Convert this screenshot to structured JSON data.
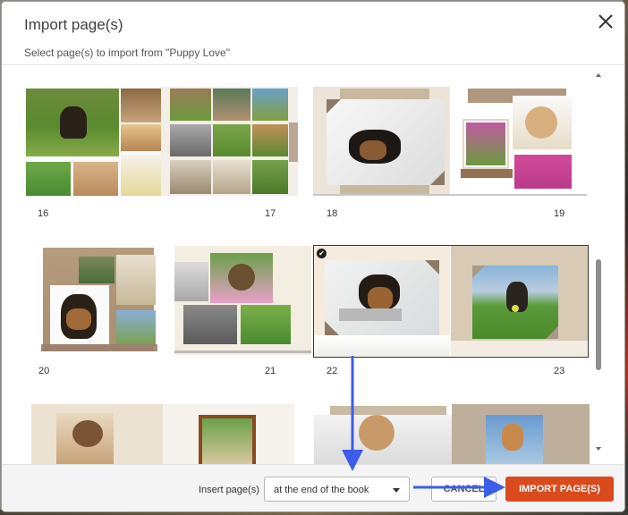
{
  "dialog": {
    "title": "Import page(s)",
    "subtitle": "Select page(s) to import from \"Puppy Love\"",
    "close_icon": "close-icon"
  },
  "spreads": [
    {
      "left_page": "16",
      "right_page": "17",
      "selected": false
    },
    {
      "left_page": "18",
      "right_page": "19",
      "selected": false
    },
    {
      "left_page": "20",
      "right_page": "21",
      "selected": false
    },
    {
      "left_page": "22",
      "right_page": "23",
      "selected": true
    },
    {
      "left_page": "",
      "right_page": "",
      "selected": false
    },
    {
      "left_page": "",
      "right_page": "",
      "selected": false
    }
  ],
  "selection": {
    "check_icon": "checkmark-icon",
    "glyph": "✔"
  },
  "footer": {
    "insert_label": "Insert page(s)",
    "insert_select": {
      "value": "at the end of the book"
    },
    "cancel_label": "CANCEL",
    "import_label": "IMPORT PAGE(S)"
  },
  "colors": {
    "primary": "#d94a1c",
    "annotation_arrow": "#3d5ce8",
    "selection_border": "#3a3a3a"
  }
}
